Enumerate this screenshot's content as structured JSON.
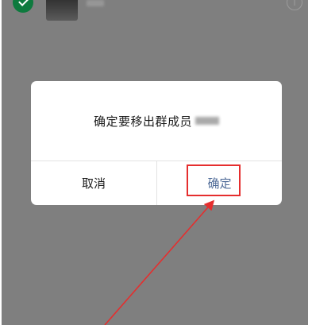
{
  "dialog": {
    "message": "确定要移出群成员",
    "cancel_label": "取消",
    "confirm_label": "确定"
  },
  "colors": {
    "overlay": "#7f7f7f",
    "confirm_text": "#4f6b98",
    "annotation": "#e52e2e",
    "selected_check": "#0e7a3e"
  },
  "icons": {
    "selected": "check-circle-icon",
    "info": "info-icon"
  },
  "info_glyph": "i"
}
